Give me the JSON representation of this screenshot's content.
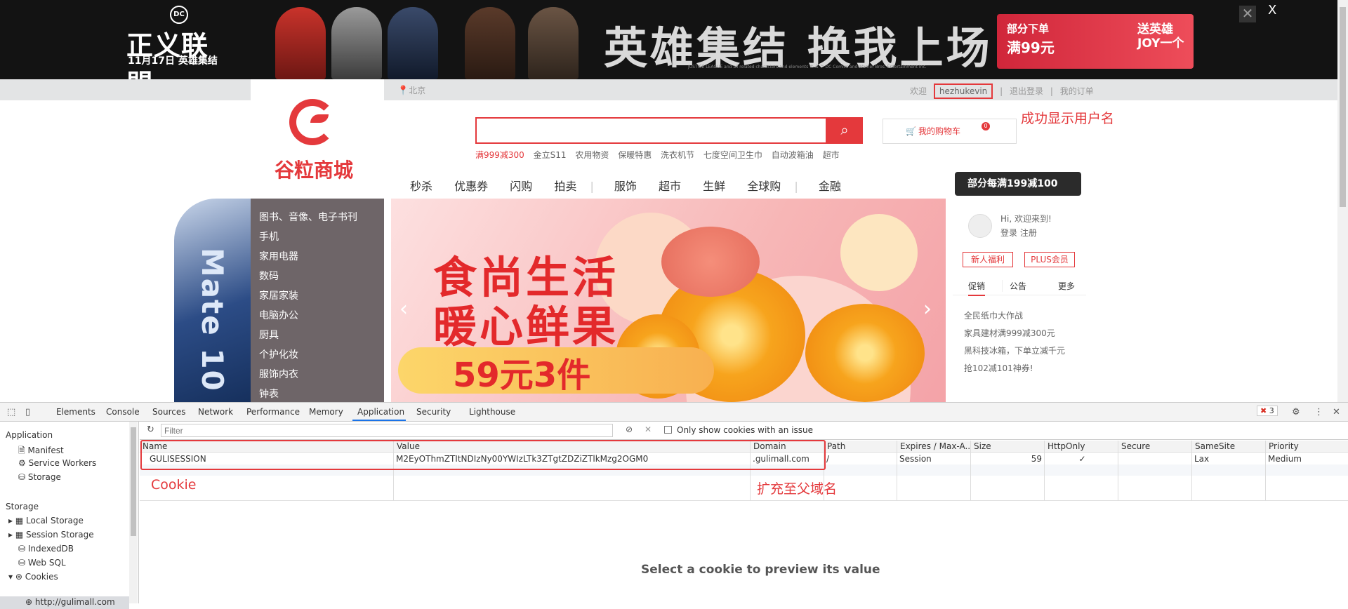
{
  "banner": {
    "dc_logo": "DC",
    "dc_title": "正义联盟",
    "dc_sub": "11月17日 英雄集结",
    "slogan": "英雄集结 换我上场",
    "fine_print": "JUSTICE LEAGUE and all related characters and elements © & ™ DC Comics and Warner Bros. Entertainment Inc.",
    "promo_line1": "部分下单",
    "promo_line2": "满99元",
    "promo_right": "送英雄 JOY一个",
    "close_label": "X"
  },
  "topbar": {
    "location": "北京",
    "welcome": "欢迎",
    "username": "hezhukevin",
    "logout": "退出登录",
    "orders": "我的订单",
    "caption": "成功显示用户名"
  },
  "header": {
    "store_name": "谷粒商城",
    "search_placeholder": "",
    "hotwords": [
      "满999减300",
      "金立S11",
      "农用物资",
      "保暖特惠",
      "洗衣机节",
      "七度空间卫生巾",
      "自动波箱油",
      "超市"
    ],
    "cart_label": "我的购物车",
    "cart_count": "0",
    "nav": [
      "秒杀",
      "优惠券",
      "闪购",
      "拍卖",
      "服饰",
      "超市",
      "生鲜",
      "全球购",
      "金融"
    ],
    "promo_tag": "部分每满199减100"
  },
  "side_ad": "Mate 10",
  "categories": [
    "图书、音像、电子书刊",
    "手机",
    "家用电器",
    "数码",
    "家居家装",
    "电脑办公",
    "厨具",
    "个护化妆",
    "服饰内衣",
    "钟表"
  ],
  "carousel": {
    "line1": "食尚生活",
    "line2": "暖心鲜果",
    "price": "59元3件"
  },
  "right_panel": {
    "hi": "Hi, 欢迎来到!",
    "login": "登录 注册",
    "btn_new": "新人福利",
    "btn_plus": "PLUS会员",
    "tab1": "促销",
    "tab2": "公告",
    "tab3": "更多",
    "news": [
      "全民纸巾大作战",
      "家具建材满999减300元",
      "黑科技冰箱，下单立减千元",
      "抢102减101神券!"
    ]
  },
  "devtools": {
    "tabs": [
      "Elements",
      "Console",
      "Sources",
      "Network",
      "Performance",
      "Memory",
      "Application",
      "Security",
      "Lighthouse"
    ],
    "error_count": "3",
    "sidebar": {
      "app_section": "Application",
      "manifest": "Manifest",
      "service_workers": "Service Workers",
      "storage_item": "Storage",
      "storage_section": "Storage",
      "local_storage": "Local Storage",
      "session_storage": "Session Storage",
      "indexeddb": "IndexedDB",
      "websql": "Web SQL",
      "cookies": "Cookies",
      "cookie_origin": "http://gulimall.com"
    },
    "filter_placeholder": "Filter",
    "only_issues": "Only show cookies with an issue",
    "columns": [
      "Name",
      "Value",
      "Domain",
      "Path",
      "Expires / Max-A...",
      "Size",
      "HttpOnly",
      "Secure",
      "SameSite",
      "Priority"
    ],
    "cookie": {
      "name": "GULISESSION",
      "value": "M2EyOThmZTItNDIzNy00YWIzLTk3ZTgtZDZiZTlkMzg2OGM0",
      "domain": ".gulimall.com",
      "path": "/",
      "expires": "Session",
      "size": "59",
      "httponly": "✓",
      "secure": "",
      "samesite": "Lax",
      "priority": "Medium"
    },
    "annotation_cookie": "Cookie",
    "annotation_domain": "扩充至父域名",
    "preview_text": "Select a cookie to preview its value"
  }
}
